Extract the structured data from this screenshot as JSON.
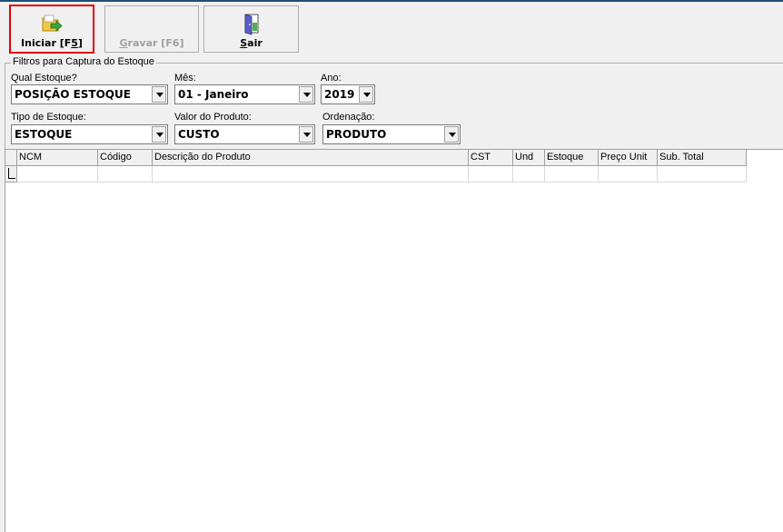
{
  "toolbar": {
    "iniciar": {
      "label_pre": "Iniciar [F",
      "label_ul": "5",
      "label_post": "]",
      "icon": "folder-arrow-icon"
    },
    "gravar": {
      "label_ul": "G",
      "label_post": "ravar [F6]",
      "icon": "none"
    },
    "sair": {
      "label_ul": "S",
      "label_post": "air",
      "icon": "door-exit-icon"
    }
  },
  "filters": {
    "title": "Filtros para Captura do Estoque",
    "qual_estoque": {
      "label": "Qual Estoque?",
      "value": "POSIÇÃO ESTOQUE"
    },
    "mes": {
      "label": "Mês:",
      "value": "01 - Janeiro"
    },
    "ano": {
      "label": "Ano:",
      "value": "2019"
    },
    "tipo_estoque": {
      "label": "Tipo de Estoque:",
      "value": "ESTOQUE"
    },
    "valor_produto": {
      "label": "Valor do Produto:",
      "value": "CUSTO"
    },
    "ordenacao": {
      "label": "Ordenação:",
      "value": "PRODUTO"
    }
  },
  "grid": {
    "columns": [
      "NCM",
      "Código",
      "Descrição do Produto",
      "CST",
      "Und",
      "Estoque",
      "Preço Unit",
      "Sub. Total"
    ]
  },
  "colors": {
    "accent_highlight": "#e00000",
    "title_bar": "#1f4e79"
  }
}
